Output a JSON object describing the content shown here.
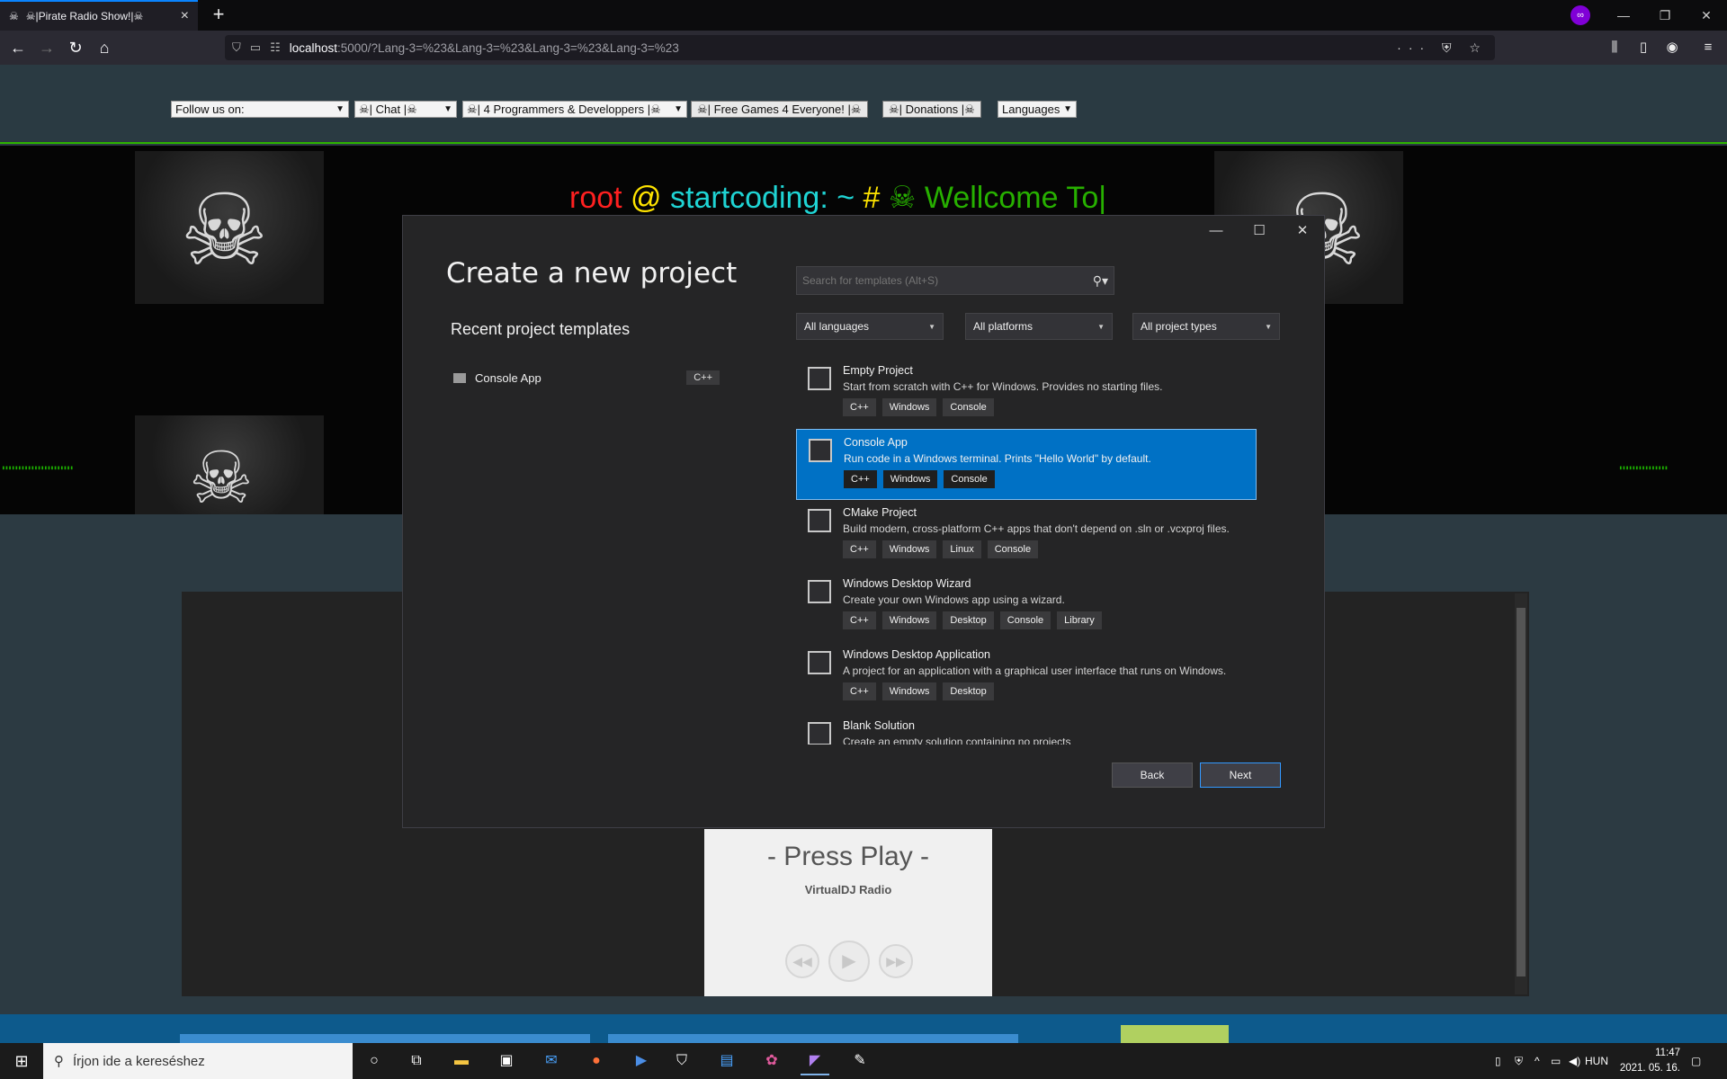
{
  "browser": {
    "tab_title": "☠|Pirate Radio Show!|☠",
    "url_host": "localhost",
    "url_rest": ":5000/?Lang-3=%23&Lang-3=%23&Lang-3=%23&Lang-3=%23",
    "new_tab_label": "+",
    "url_actions": "··· ⛨ ☆"
  },
  "site": {
    "menu": {
      "follow": "Follow us on:",
      "chat": "☠| Chat |☠",
      "programmers": "☠| 4 Programmers & Developpers |☠",
      "games": "☠| Free Games 4 Everyone! |☠",
      "donations": "☠| Donations |☠",
      "languages": "Languages"
    },
    "terminal": {
      "root": "root",
      "at": "@",
      "host": "startcoding:",
      "tilde": "~",
      "hash": "#",
      "welcome": "☠ Wellcome To|"
    },
    "player": {
      "press_play": "- Press Play -",
      "station": "VirtualDJ Radio"
    }
  },
  "dialog": {
    "title": "Create a new project",
    "recent_title": "Recent project templates",
    "recent_items": [
      {
        "label": "Console App",
        "tag": "C++"
      }
    ],
    "search_placeholder": "Search for templates (Alt+S)",
    "filters": {
      "languages": "All languages",
      "platforms": "All platforms",
      "project_types": "All project types"
    },
    "templates": [
      {
        "name": "Empty Project",
        "desc": "Start from scratch with C++ for Windows. Provides no starting files.",
        "tags": [
          "C++",
          "Windows",
          "Console"
        ],
        "selected": false
      },
      {
        "name": "Console App",
        "desc": "Run code in a Windows terminal. Prints \"Hello World\" by default.",
        "tags": [
          "C++",
          "Windows",
          "Console"
        ],
        "selected": true
      },
      {
        "name": "CMake Project",
        "desc": "Build modern, cross-platform C++ apps that don't depend on .sln or .vcxproj files.",
        "tags": [
          "C++",
          "Windows",
          "Linux",
          "Console"
        ],
        "selected": false
      },
      {
        "name": "Windows Desktop Wizard",
        "desc": "Create your own Windows app using a wizard.",
        "tags": [
          "C++",
          "Windows",
          "Desktop",
          "Console",
          "Library"
        ],
        "selected": false
      },
      {
        "name": "Windows Desktop Application",
        "desc": "A project for an application with a graphical user interface that runs on Windows.",
        "tags": [
          "C++",
          "Windows",
          "Desktop"
        ],
        "selected": false
      },
      {
        "name": "Blank Solution",
        "desc": "Create an empty solution containing no projects",
        "tags": [],
        "selected": false
      }
    ],
    "back_label": "Back",
    "next_label": "Next"
  },
  "taskbar": {
    "search_placeholder": "Írjon ide a kereséshez",
    "language": "HUN",
    "time": "11:47",
    "date": "2021. 05. 16."
  }
}
